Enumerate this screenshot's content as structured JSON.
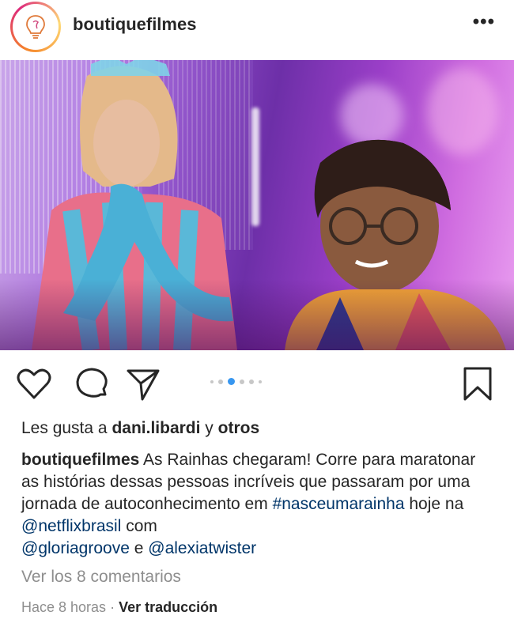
{
  "post": {
    "username": "boutiquefilmes",
    "more_label": "•••",
    "likes_prefix": "Les gusta a",
    "likes_user": "dani.libardi",
    "likes_joiner": "y",
    "likes_others": "otros",
    "caption": {
      "author": "boutiquefilmes",
      "text1": "As Rainhas chegaram! Corre para maratonar as histórias dessas pessoas incríveis que passaram por uma jornada de autoconhecimento em",
      "hashtag": "#nasceumarainha",
      "text2": "hoje na",
      "mention1": "@netflixbrasil",
      "text3": "com",
      "mention2": "@gloriagroove",
      "text4": "e",
      "mention3": "@alexiatwister"
    },
    "view_comments": "Ver los 8 comentarios",
    "time_ago": "Hace 8 horas",
    "separator": "·",
    "translate": "Ver traducción",
    "carousel": {
      "count": 6,
      "active_index": 2
    }
  },
  "icons": [
    "avatar-lightbulb-icon",
    "heart-icon",
    "comment-icon",
    "share-icon",
    "bookmark-icon"
  ],
  "colors": {
    "link": "#003569",
    "dot_active": "#3897f0",
    "muted": "#8e8e8e"
  }
}
